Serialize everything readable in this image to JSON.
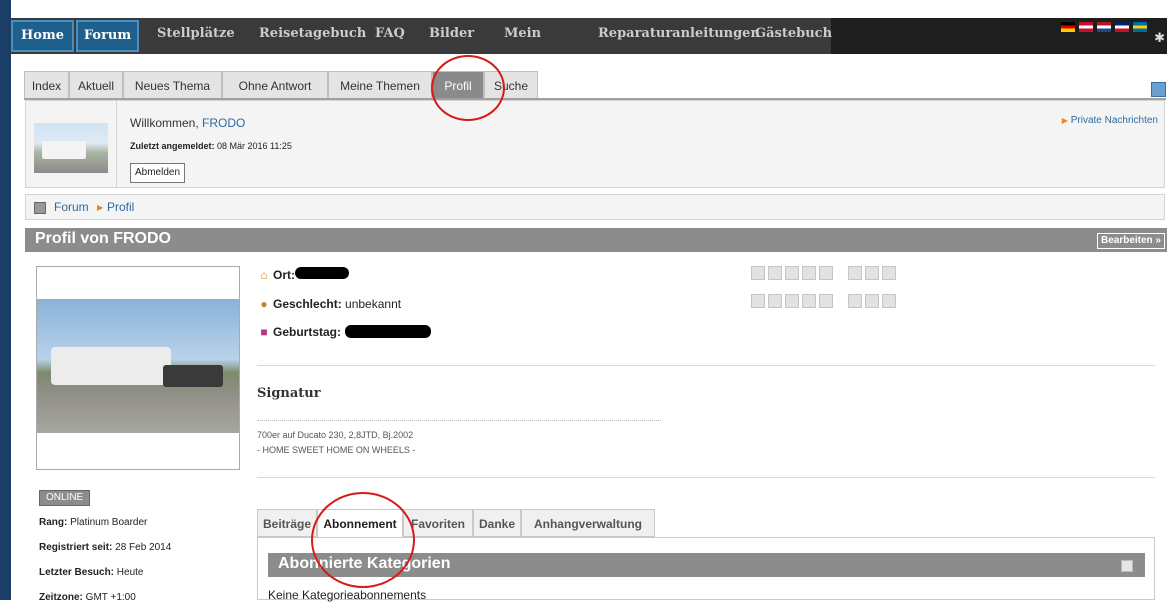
{
  "nav": {
    "items": [
      {
        "label": "Home"
      },
      {
        "label": "Forum"
      },
      {
        "label": "Stellplätze"
      },
      {
        "label": "Reisetagebuch"
      },
      {
        "label": "FAQ"
      },
      {
        "label": "Bilder"
      },
      {
        "label": "Mein Profil"
      },
      {
        "label": "Reparaturanleitungen"
      },
      {
        "label": "Gästebuch"
      }
    ],
    "dropdown_caret": "⌄",
    "gear": "✱",
    "flag_colors": [
      [
        "#000000",
        "#dd0000",
        "#ffce00"
      ],
      [
        "#c8102e",
        "#ffffff",
        "#c8102e"
      ],
      [
        "#ae1c28",
        "#ffffff",
        "#21468b"
      ],
      [
        "#012169",
        "#ffffff",
        "#c8102e"
      ],
      [
        "#006aa7",
        "#fecc00",
        "#006aa7"
      ]
    ]
  },
  "subtabs": [
    {
      "label": "Index"
    },
    {
      "label": "Aktuell"
    },
    {
      "label": "Neues Thema"
    },
    {
      "label": "Ohne Antwort"
    },
    {
      "label": "Meine Themen"
    },
    {
      "label": "Profil"
    },
    {
      "label": "Suche"
    }
  ],
  "userbox": {
    "welcome_prefix": "Willkommen, ",
    "username": "FRODO",
    "lastlogin_label": "Zuletzt angemeldet:",
    "lastlogin_value": " 08 Mär 2016 11:25",
    "logout": "Abmelden",
    "private_messages": "Private Nachrichten"
  },
  "breadcrumb": {
    "items": [
      "Forum",
      "Profil"
    ]
  },
  "profile": {
    "title": "Profil von FRODO",
    "edit": "Bearbeiten »",
    "status": "ONLINE",
    "rank_label": "Rang:",
    "rank_value": " Platinum Boarder",
    "registered_label": "Registriert seit:",
    "registered_value": " 28 Feb 2014",
    "lastvisit_label": "Letzter Besuch:",
    "lastvisit_value": " Heute",
    "timezone_label": "Zeitzone:",
    "timezone_value": " GMT +1:00",
    "location_label": "Ort:",
    "gender_label": "Geschlecht:",
    "gender_value": " unbekannt",
    "birthday_label": "Geburtstag:",
    "signature_title": "Signatur",
    "signature_lines": [
      "700er auf Ducato 230, 2,8JTD, Bj.2002",
      "- HOME SWEET HOME ON WHEELS -"
    ]
  },
  "profile_tabs": [
    {
      "label": "Beiträge"
    },
    {
      "label": "Abonnement"
    },
    {
      "label": "Favoriten"
    },
    {
      "label": "Danke"
    },
    {
      "label": "Anhangverwaltung"
    }
  ],
  "subscriptions": {
    "title": "Abonnierte Kategorien",
    "empty": "Keine Kategorieabonnements"
  }
}
